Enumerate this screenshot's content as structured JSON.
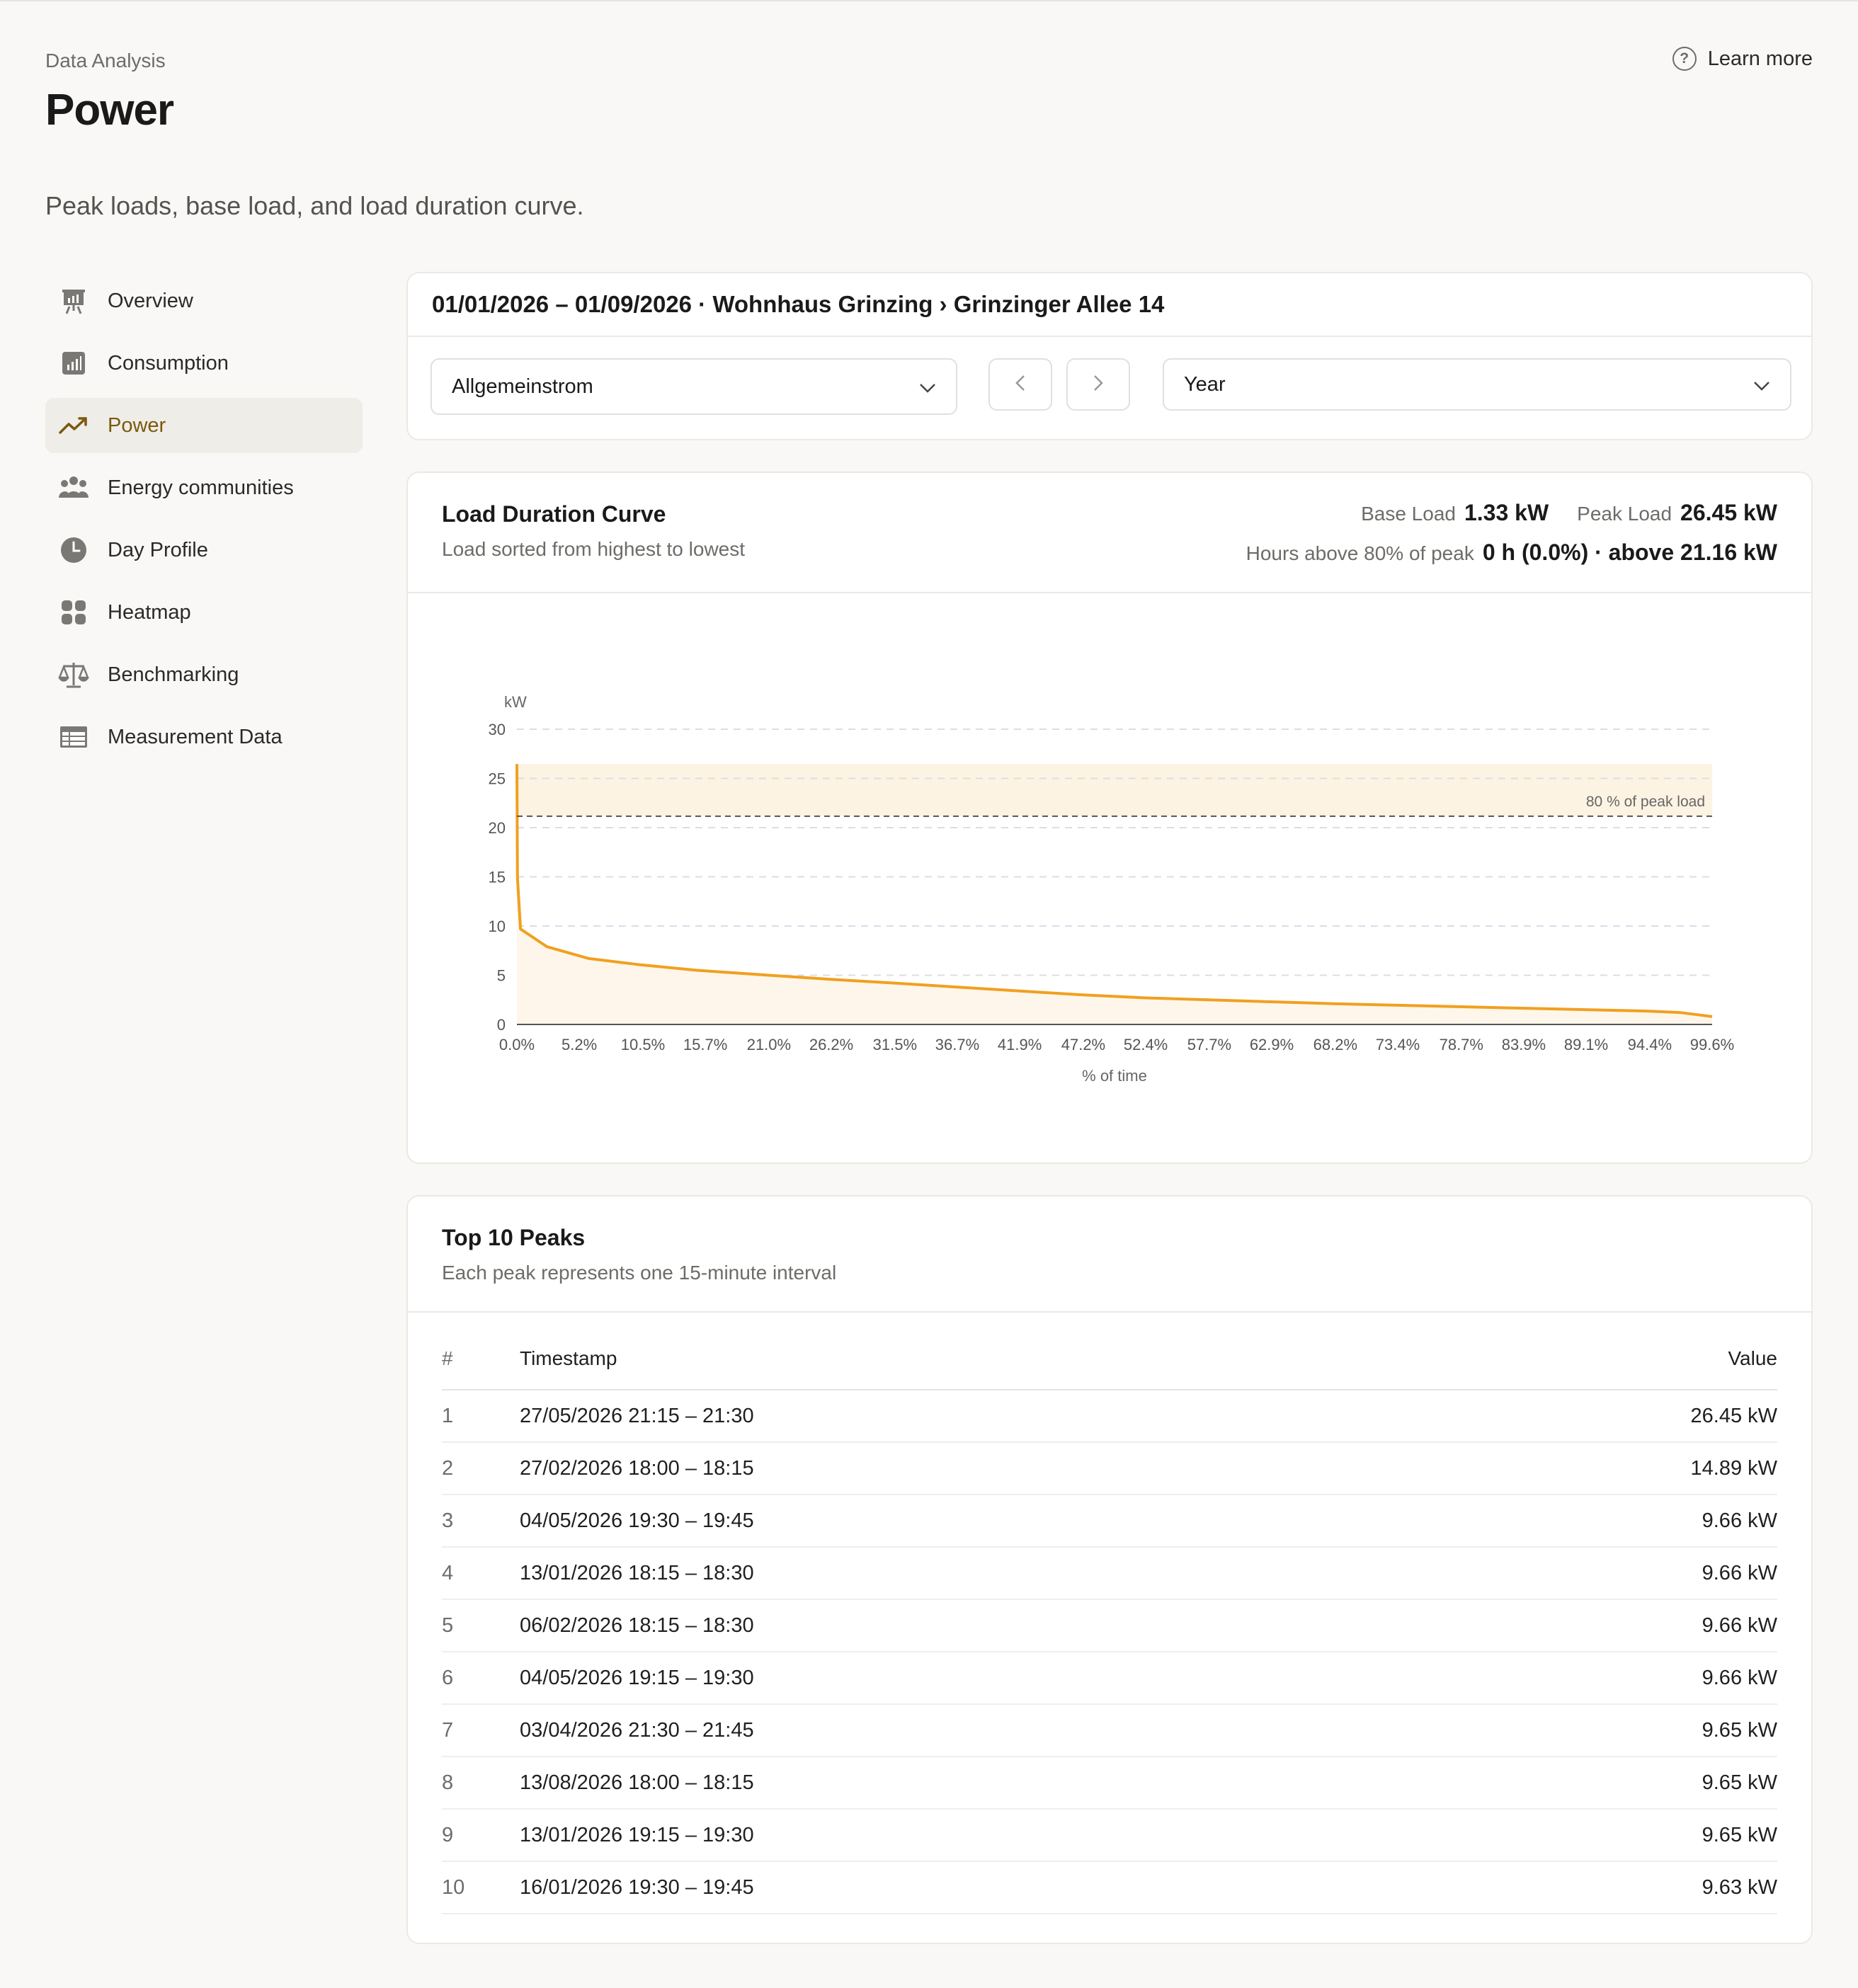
{
  "header": {
    "breadcrumb": "Data Analysis",
    "title": "Power",
    "subtitle": "Peak loads, base load, and load duration curve.",
    "learn_more": "Learn more"
  },
  "sidebar": {
    "items": [
      {
        "label": "Overview",
        "icon": "presentation-chart-icon"
      },
      {
        "label": "Consumption",
        "icon": "bar-chart-icon"
      },
      {
        "label": "Power",
        "icon": "trending-up-icon",
        "active": true
      },
      {
        "label": "Energy communities",
        "icon": "people-group-icon"
      },
      {
        "label": "Day Profile",
        "icon": "clock-icon"
      },
      {
        "label": "Heatmap",
        "icon": "grid-icon"
      },
      {
        "label": "Benchmarking",
        "icon": "scale-icon"
      },
      {
        "label": "Measurement Data",
        "icon": "table-icon"
      }
    ]
  },
  "filters": {
    "heading": "01/01/2026 – 01/09/2026 · Wohnhaus Grinzing › Grinzinger Allee 14",
    "meter": "Allgemeinstrom",
    "period": "Year"
  },
  "ldc": {
    "title": "Load Duration Curve",
    "subtitle": "Load sorted from highest to lowest",
    "base_load_label": "Base Load",
    "base_load": "1.33 kW",
    "peak_load_label": "Peak Load",
    "peak_load": "26.45 kW",
    "hours_label": "Hours above 80% of peak",
    "hours_value": "0 h (0.0%) · above 21.16 kW"
  },
  "chart_data": {
    "type": "area",
    "ylabel": "kW",
    "xlabel": "% of time",
    "ylim": [
      0,
      30
    ],
    "yticks": [
      0,
      5,
      10,
      15,
      20,
      25,
      30
    ],
    "xticks": [
      "0.0%",
      "5.2%",
      "10.5%",
      "15.7%",
      "21.0%",
      "26.2%",
      "31.5%",
      "36.7%",
      "41.9%",
      "47.2%",
      "52.4%",
      "57.7%",
      "62.9%",
      "68.2%",
      "73.4%",
      "78.7%",
      "83.9%",
      "89.1%",
      "94.4%",
      "99.6%"
    ],
    "reference_line": {
      "label": "80 % of peak load",
      "value": 21.16
    },
    "band": [
      21.16,
      26.45
    ],
    "grid": true,
    "line_color": "#f0a020",
    "series": [
      {
        "x": [
          0.0,
          0.05,
          0.3,
          2.5,
          6.0,
          10.0,
          15.0,
          21.0,
          26.0,
          31.5,
          36.7,
          41.9,
          47.2,
          52.4,
          57.7,
          62.9,
          68.2,
          73.4,
          78.7,
          83.9,
          89.1,
          94.4,
          97.0,
          99.6
        ],
        "y": [
          26.45,
          14.89,
          9.7,
          7.9,
          6.7,
          6.1,
          5.5,
          5.0,
          4.6,
          4.2,
          3.8,
          3.4,
          3.0,
          2.7,
          2.5,
          2.3,
          2.1,
          1.95,
          1.8,
          1.65,
          1.5,
          1.35,
          1.2,
          0.8
        ]
      }
    ]
  },
  "peaks": {
    "title": "Top 10 Peaks",
    "subtitle": "Each peak represents one 15-minute interval",
    "columns": {
      "rank": "#",
      "timestamp": "Timestamp",
      "value": "Value"
    },
    "rows": [
      {
        "rank": "1",
        "timestamp": "27/05/2026 21:15 – 21:30",
        "value": "26.45 kW"
      },
      {
        "rank": "2",
        "timestamp": "27/02/2026 18:00 – 18:15",
        "value": "14.89 kW"
      },
      {
        "rank": "3",
        "timestamp": "04/05/2026 19:30 – 19:45",
        "value": "9.66 kW"
      },
      {
        "rank": "4",
        "timestamp": "13/01/2026 18:15 – 18:30",
        "value": "9.66 kW"
      },
      {
        "rank": "5",
        "timestamp": "06/02/2026 18:15 – 18:30",
        "value": "9.66 kW"
      },
      {
        "rank": "6",
        "timestamp": "04/05/2026 19:15 – 19:30",
        "value": "9.66 kW"
      },
      {
        "rank": "7",
        "timestamp": "03/04/2026 21:30 – 21:45",
        "value": "9.65 kW"
      },
      {
        "rank": "8",
        "timestamp": "13/08/2026 18:00 – 18:15",
        "value": "9.65 kW"
      },
      {
        "rank": "9",
        "timestamp": "13/01/2026 19:15 – 19:30",
        "value": "9.65 kW"
      },
      {
        "rank": "10",
        "timestamp": "16/01/2026 19:30 – 19:45",
        "value": "9.63 kW"
      }
    ]
  }
}
